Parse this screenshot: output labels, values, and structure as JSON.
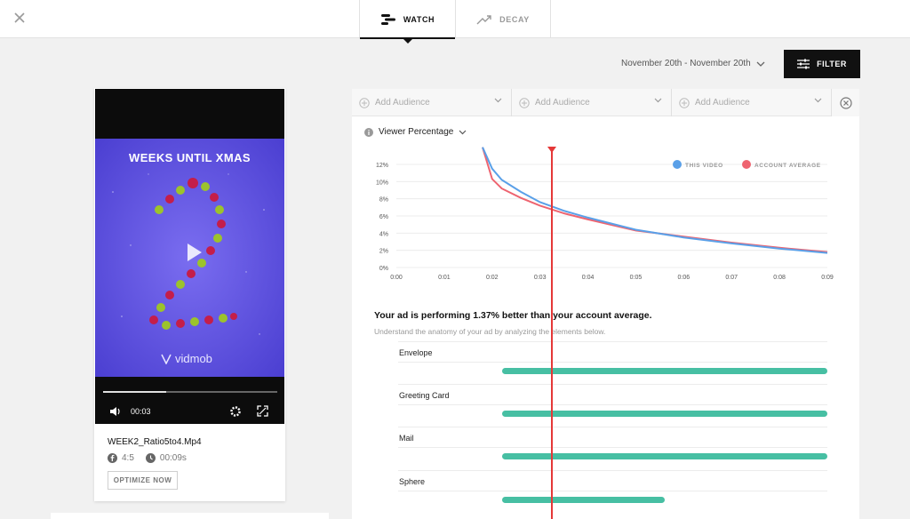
{
  "tabs": [
    {
      "label": "WATCH",
      "active": true
    },
    {
      "label": "DECAY",
      "active": false
    }
  ],
  "date_range": "November 20th - November 20th",
  "filter_label": "FILTER",
  "audiences": [
    "Add Audience",
    "Add Audience",
    "Add Audience"
  ],
  "video": {
    "title": "WEEKS UNTIL XMAS",
    "brand": "vidmob",
    "current_time": "00:03",
    "progress": 0.36,
    "file_name": "WEEK2_Ratio5to4.Mp4",
    "ratio": "4:5",
    "duration": "00:09s",
    "optimize_label": "OPTIMIZE NOW"
  },
  "chart": {
    "label": "Viewer Percentage",
    "legend": [
      "THIS VIDEO",
      "ACCOUNT AVERAGE"
    ],
    "colors": {
      "this_video": "#5aa0e8",
      "account_average": "#ee6470",
      "playhead": "#e53838",
      "bar": "#47bfa3"
    }
  },
  "chart_data": {
    "type": "line",
    "x_ticks": [
      "0:00",
      "0:01",
      "0:02",
      "0:03",
      "0:04",
      "0:05",
      "0:06",
      "0:07",
      "0:08",
      "0:09"
    ],
    "y_ticks": [
      "0%",
      "2%",
      "4%",
      "6%",
      "8%",
      "10%",
      "12%"
    ],
    "ylim": [
      0,
      12
    ],
    "xlim": [
      0,
      9
    ],
    "series": [
      {
        "name": "THIS VIDEO",
        "color": "#5aa0e8",
        "x": [
          1.8,
          2.0,
          2.2,
          2.6,
          3.0,
          3.5,
          4.0,
          5.0,
          6.0,
          7.0,
          8.0,
          9.0
        ],
        "y": [
          14,
          11.5,
          10.2,
          8.8,
          7.6,
          6.6,
          5.8,
          4.4,
          3.5,
          2.8,
          2.2,
          1.7
        ]
      },
      {
        "name": "ACCOUNT AVERAGE",
        "color": "#ee6470",
        "x": [
          1.8,
          2.0,
          2.2,
          2.6,
          3.0,
          3.5,
          4.0,
          5.0,
          6.0,
          7.0,
          8.0,
          9.0
        ],
        "y": [
          14,
          10.3,
          9.2,
          8.1,
          7.2,
          6.3,
          5.6,
          4.3,
          3.6,
          2.9,
          2.3,
          1.8
        ]
      }
    ],
    "playhead_time": 3.2
  },
  "performance": {
    "title": "Your ad is performing 1.37% better than your account average.",
    "subtitle": "Understand the anatomy of your ad by analyzing the elements below."
  },
  "elements": [
    {
      "label": "Envelope",
      "start": 2.2,
      "end": 9.0
    },
    {
      "label": "Greeting Card",
      "start": 2.2,
      "end": 9.0
    },
    {
      "label": "Mail",
      "start": 2.2,
      "end": 9.0
    },
    {
      "label": "Sphere",
      "start": 2.2,
      "end": 5.6
    }
  ]
}
